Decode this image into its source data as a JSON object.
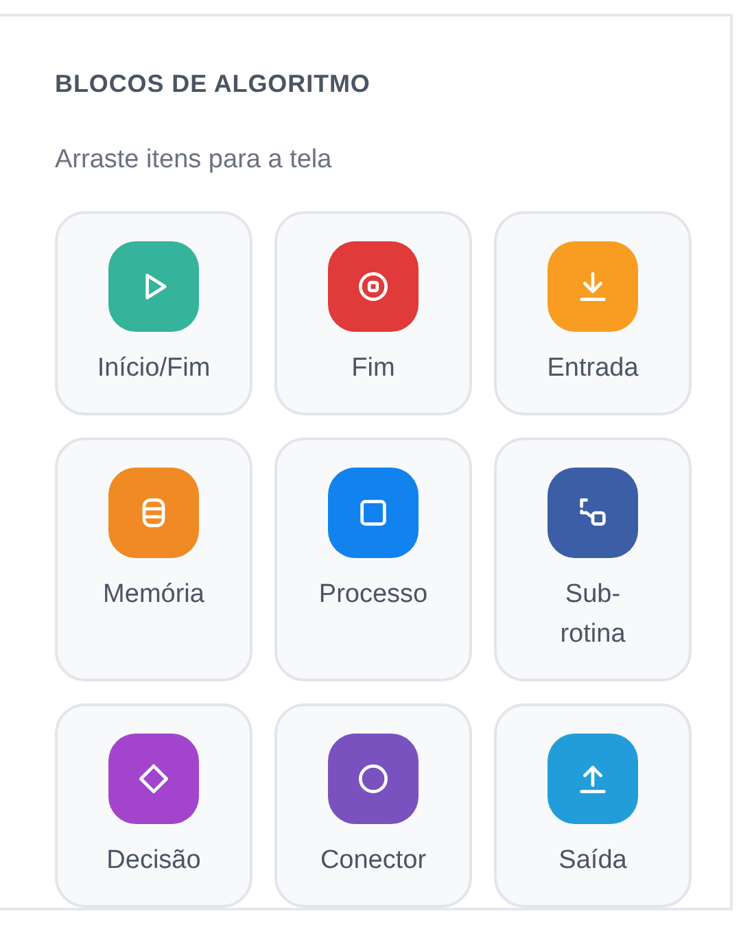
{
  "panel": {
    "title": "BLOCOS DE ALGORITMO",
    "subtitle": "Arraste itens para a tela"
  },
  "blocks": [
    {
      "label": "Início/Fim",
      "kind": "play",
      "color": "#36b39b"
    },
    {
      "label": "Fim",
      "kind": "stop",
      "color": "#e03a3a"
    },
    {
      "label": "Entrada",
      "kind": "download",
      "color": "#f89d22"
    },
    {
      "label": "Memória",
      "kind": "database",
      "color": "#f08a24"
    },
    {
      "label": "Processo",
      "kind": "square",
      "color": "#1282ee"
    },
    {
      "label": "Sub-\nrotina",
      "kind": "subroutine",
      "color": "#3b5ea6"
    },
    {
      "label": "Decisão",
      "kind": "diamond",
      "color": "#a245cc"
    },
    {
      "label": "Conector",
      "kind": "circle",
      "color": "#7952c0"
    },
    {
      "label": "Saída",
      "kind": "upload",
      "color": "#239dd9"
    }
  ]
}
